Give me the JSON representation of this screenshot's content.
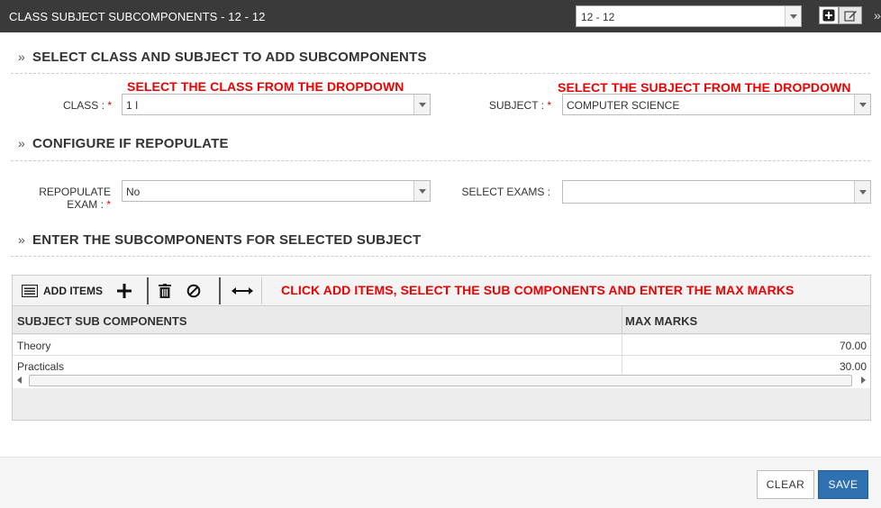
{
  "header": {
    "title": "CLASS SUBJECT SUBCOMPONENTS - 12 - 12",
    "year_select": "12 - 12",
    "more": "»"
  },
  "sections": {
    "select": "SELECT CLASS AND SUBJECT TO ADD SUBCOMPONENTS",
    "repopulate": "CONFIGURE IF REPOPULATE",
    "enter": "ENTER THE SUBCOMPONENTS FOR SELECTED SUBJECT"
  },
  "hints": {
    "class": "SELECT THE CLASS FROM THE DROPDOWN",
    "subject": "SELECT THE SUBJECT FROM THE DROPDOWN",
    "grid": "CLICK ADD ITEMS, SELECT THE SUB COMPONENTS AND ENTER THE MAX MARKS"
  },
  "form": {
    "class_label": "CLASS :",
    "class_value": "1 I",
    "subject_label": "SUBJECT :",
    "subject_value": "COMPUTER SCIENCE",
    "repopulate_label_1": "REPOPULATE",
    "repopulate_label_2": "EXAM :",
    "repopulate_value": "No",
    "select_exams_label": "SELECT EXAMS :",
    "select_exams_value": "",
    "required_mark": "*"
  },
  "grid": {
    "add_items_label": "ADD ITEMS",
    "columns": [
      "SUBJECT SUB COMPONENTS",
      "MAX MARKS"
    ],
    "rows": [
      {
        "component": "Theory",
        "max_marks": "70.00"
      },
      {
        "component": "Practicals",
        "max_marks": "30.00"
      }
    ]
  },
  "footer": {
    "clear_label": "CLEAR",
    "save_label": "SAVE"
  },
  "colors": {
    "title_bar": "#3a3a3a",
    "hint_red": "#e00000",
    "save_blue": "#2f70b0"
  }
}
